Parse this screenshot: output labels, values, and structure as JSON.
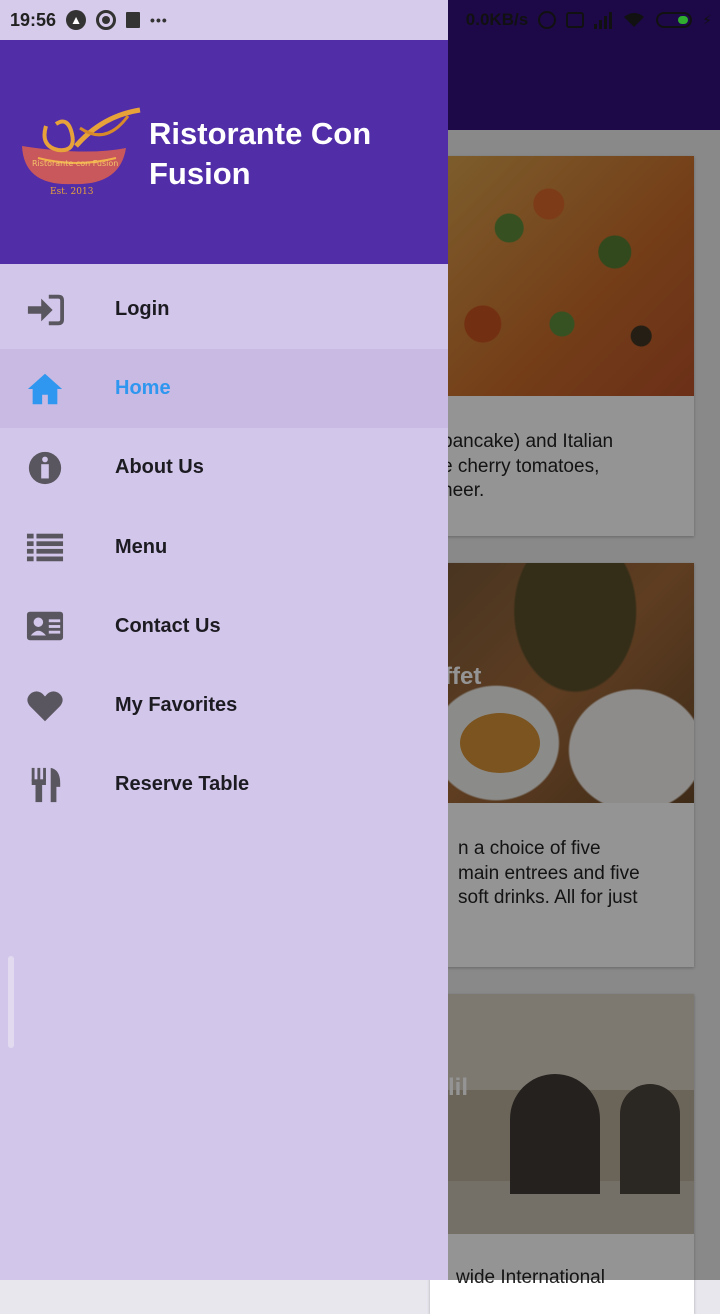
{
  "status_bar": {
    "time": "19:56",
    "left_icons": [
      "nav-notification-icon",
      "sync-icon",
      "trash-icon",
      "more-dots-icon"
    ],
    "network_speed": "0.0KB/s",
    "right_icons": [
      "alarm-icon",
      "sim-icon",
      "signal-icon",
      "wifi-icon",
      "battery-icon",
      "charging-icon"
    ]
  },
  "drawer": {
    "app_title": "Ristorante Con Fusion",
    "logo": {
      "text_top": "Ristorante con Fusion",
      "text_bottom": "Est. 2013"
    },
    "items": [
      {
        "label": "Login",
        "icon": "sign-in-icon",
        "active": false
      },
      {
        "label": "Home",
        "icon": "home-icon",
        "active": true
      },
      {
        "label": "About Us",
        "icon": "info-circle-icon",
        "active": false
      },
      {
        "label": "Menu",
        "icon": "list-icon",
        "active": false
      },
      {
        "label": "Contact Us",
        "icon": "address-card-icon",
        "active": false
      },
      {
        "label": "My Favorites",
        "icon": "heart-icon",
        "active": false
      },
      {
        "label": "Reserve Table",
        "icon": "cutlery-icon",
        "active": false
      }
    ]
  },
  "background_content": {
    "cards": [
      {
        "overlay_title": "",
        "text": "pancake) and Italian\ne cherry tomatoes,\nneer."
      },
      {
        "overlay_title": "ffet",
        "text": "n a choice of five\nmain entrees and five\nsoft drinks. All for just"
      },
      {
        "overlay_title": "lil",
        "text": "wide International"
      }
    ]
  },
  "colors": {
    "drawer_header": "#512da8",
    "drawer_body": "#d2c7ea",
    "active_item_bg": "#c9bae3",
    "active_item_text": "#2f97ef"
  }
}
